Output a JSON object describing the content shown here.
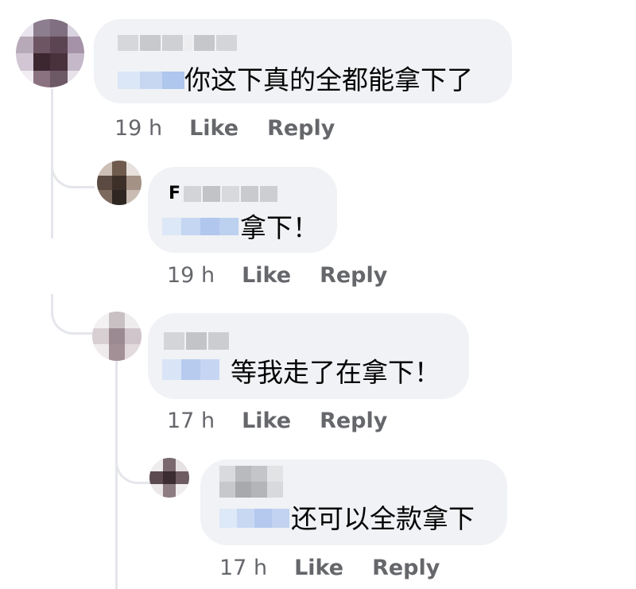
{
  "comments": [
    {
      "text": "你这下真的全都能拿下了",
      "time": "19 h",
      "like": "Like",
      "reply": "Reply"
    },
    {
      "name_initial": "F",
      "text": "拿下！",
      "time": "19 h",
      "like": "Like",
      "reply": "Reply"
    },
    {
      "text": "等我走了在拿下！",
      "time": "17 h",
      "like": "Like",
      "reply": "Reply"
    },
    {
      "text": "还可以全款拿下",
      "time": "17 h",
      "like": "Like",
      "reply": "Reply"
    }
  ]
}
